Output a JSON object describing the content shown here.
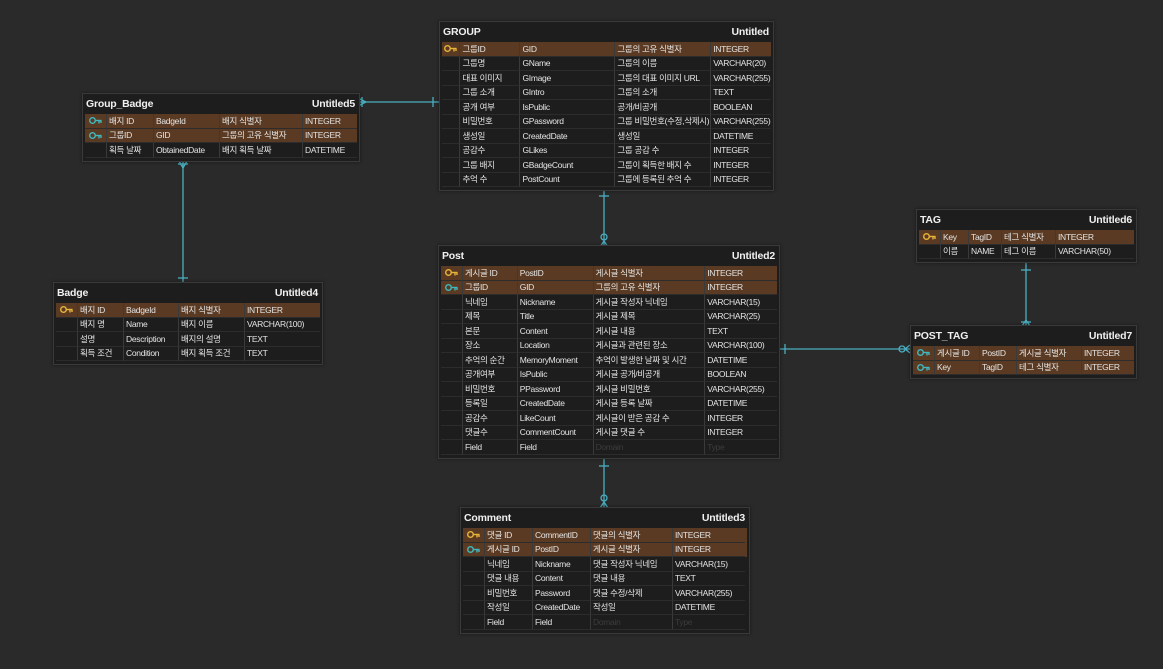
{
  "colors": {
    "pk_row": "#5a3a22",
    "key_gold": "#e8b43c",
    "key_teal": "#3fb8c0",
    "link": "#4aaec0"
  },
  "entities": {
    "group": {
      "name": "GROUP",
      "table": "Untitled",
      "rows": [
        {
          "key": "gold",
          "c1": "그룹ID",
          "c2": "GID",
          "c3": "그룹의 고유 식별자",
          "c4": "INTEGER"
        },
        {
          "key": "",
          "c1": "그룹명",
          "c2": "GName",
          "c3": "그룹의 이름",
          "c4": "VARCHAR(20)"
        },
        {
          "key": "",
          "c1": "대표 이미지",
          "c2": "GImage",
          "c3": "그룹의 대표 이미지 URL",
          "c4": "VARCHAR(255)"
        },
        {
          "key": "",
          "c1": "그룹 소개",
          "c2": "GIntro",
          "c3": "그룹의 소개",
          "c4": "TEXT"
        },
        {
          "key": "",
          "c1": "공개 여부",
          "c2": "IsPublic",
          "c3": "공개/비공개",
          "c4": "BOOLEAN"
        },
        {
          "key": "",
          "c1": "비밀번호",
          "c2": "GPassword",
          "c3": "그룹 비밀번호(수정,삭제시)",
          "c4": "VARCHAR(255)"
        },
        {
          "key": "",
          "c1": "생성일",
          "c2": "CreatedDate",
          "c3": "생성일",
          "c4": "DATETIME"
        },
        {
          "key": "",
          "c1": "공감수",
          "c2": "GLikes",
          "c3": "그룹 공감 수",
          "c4": "INTEGER"
        },
        {
          "key": "",
          "c1": "그룹 배지",
          "c2": "GBadgeCount",
          "c3": "그룹이 획득한 배지 수",
          "c4": "INTEGER"
        },
        {
          "key": "",
          "c1": "추억 수",
          "c2": "PostCount",
          "c3": "그룹에 등록된 추억 수",
          "c4": "INTEGER"
        }
      ]
    },
    "group_badge": {
      "name": "Group_Badge",
      "table": "Untitled5",
      "rows": [
        {
          "key": "teal",
          "c1": "배지 ID",
          "c2": "BadgeId",
          "c3": "배지 식별자",
          "c4": "INTEGER"
        },
        {
          "key": "teal",
          "c1": "그룹ID",
          "c2": "GID",
          "c3": "그룹의 고유 식별자",
          "c4": "INTEGER"
        },
        {
          "key": "",
          "c1": "획득 날짜",
          "c2": "ObtainedDate",
          "c3": "배지 획득 날짜",
          "c4": "DATETIME"
        }
      ]
    },
    "badge": {
      "name": "Badge",
      "table": "Untitled4",
      "rows": [
        {
          "key": "gold",
          "c1": "배지 ID",
          "c2": "BadgeId",
          "c3": "배지 식별자",
          "c4": "INTEGER"
        },
        {
          "key": "",
          "c1": "배지 명",
          "c2": "Name",
          "c3": "배지 이름",
          "c4": "VARCHAR(100)"
        },
        {
          "key": "",
          "c1": "설명",
          "c2": "Description",
          "c3": "배지의 설명",
          "c4": "TEXT"
        },
        {
          "key": "",
          "c1": "획득 조건",
          "c2": "Condition",
          "c3": "배지 획득 조건",
          "c4": "TEXT"
        }
      ]
    },
    "post": {
      "name": "Post",
      "table": "Untitled2",
      "rows": [
        {
          "key": "gold",
          "c1": "게시글 ID",
          "c2": "PostID",
          "c3": "게시글 식별자",
          "c4": "INTEGER"
        },
        {
          "key": "teal",
          "c1": "그룹ID",
          "c2": "GID",
          "c3": "그룹의 고유 식별자",
          "c4": "INTEGER"
        },
        {
          "key": "",
          "c1": "닉네임",
          "c2": "Nickname",
          "c3": "게시글 작성자 닉네임",
          "c4": "VARCHAR(15)"
        },
        {
          "key": "",
          "c1": "제목",
          "c2": "Title",
          "c3": "게시글 제목",
          "c4": "VARCHAR(25)"
        },
        {
          "key": "",
          "c1": "본문",
          "c2": "Content",
          "c3": "게시글 내용",
          "c4": "TEXT"
        },
        {
          "key": "",
          "c1": "장소",
          "c2": "Location",
          "c3": "게시글과 관련된 장소",
          "c4": "VARCHAR(100)"
        },
        {
          "key": "",
          "c1": "추억의 순간",
          "c2": "MemoryMoment",
          "c3": "추억이 발생한 날짜 및 시간",
          "c4": "DATETIME"
        },
        {
          "key": "",
          "c1": "공개여부",
          "c2": "IsPublic",
          "c3": "게시글 공개/비공개",
          "c4": "BOOLEAN"
        },
        {
          "key": "",
          "c1": "비밀번호",
          "c2": "PPassword",
          "c3": "게시글 비밀번호",
          "c4": "VARCHAR(255)"
        },
        {
          "key": "",
          "c1": "등록일",
          "c2": "CreatedDate",
          "c3": "게시글 등록 날짜",
          "c4": "DATETIME"
        },
        {
          "key": "",
          "c1": "공감수",
          "c2": "LikeCount",
          "c3": "게시글이 받은 공감 수",
          "c4": "INTEGER"
        },
        {
          "key": "",
          "c1": "댓글수",
          "c2": "CommentCount",
          "c3": "게시글 댓글 수",
          "c4": "INTEGER"
        },
        {
          "key": "",
          "c1": "Field",
          "c2": "Field",
          "c3": "Domain",
          "c4": "Type",
          "ph": true
        }
      ]
    },
    "tag": {
      "name": "TAG",
      "table": "Untitled6",
      "rows": [
        {
          "key": "gold",
          "c1": "Key",
          "c2": "TagID",
          "c3": "테그 식별자",
          "c4": "INTEGER"
        },
        {
          "key": "",
          "c1": "이름",
          "c2": "NAME",
          "c3": "테그 이름",
          "c4": "VARCHAR(50)"
        }
      ]
    },
    "post_tag": {
      "name": "POST_TAG",
      "table": "Untitled7",
      "rows": [
        {
          "key": "teal",
          "c1": "게시글 ID",
          "c2": "PostID",
          "c3": "게시글 식별자",
          "c4": "INTEGER"
        },
        {
          "key": "teal",
          "c1": "Key",
          "c2": "TagID",
          "c3": "테그 식별자",
          "c4": "INTEGER"
        }
      ]
    },
    "comment": {
      "name": "Comment",
      "table": "Untitled3",
      "rows": [
        {
          "key": "gold",
          "c1": "댓글 ID",
          "c2": "CommentID",
          "c3": "댓글의 식별자",
          "c4": "INTEGER"
        },
        {
          "key": "teal",
          "c1": "게시글 ID",
          "c2": "PostID",
          "c3": "게시글 식별자",
          "c4": "INTEGER"
        },
        {
          "key": "",
          "c1": "닉네임",
          "c2": "Nickname",
          "c3": "댓글 작성자 닉네임",
          "c4": "VARCHAR(15)"
        },
        {
          "key": "",
          "c1": "댓글 내용",
          "c2": "Content",
          "c3": "댓글 내용",
          "c4": "TEXT"
        },
        {
          "key": "",
          "c1": "비밀번호",
          "c2": "Password",
          "c3": "댓글 수정/삭제",
          "c4": "VARCHAR(255)"
        },
        {
          "key": "",
          "c1": "작성일",
          "c2": "CreatedDate",
          "c3": "작성일",
          "c4": "DATETIME"
        },
        {
          "key": "",
          "c1": "Field",
          "c2": "Field",
          "c3": "Domain",
          "c4": "Type",
          "ph": true
        }
      ]
    }
  }
}
